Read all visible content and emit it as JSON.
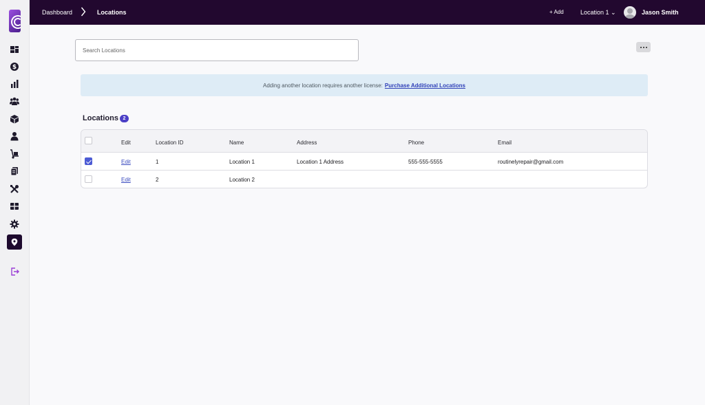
{
  "sidebar": {
    "items": [
      {
        "icon": "dashboard-icon"
      },
      {
        "icon": "dollar-icon"
      },
      {
        "icon": "bar-chart-icon"
      },
      {
        "icon": "users-icon"
      },
      {
        "icon": "box-icon"
      },
      {
        "icon": "user-icon"
      },
      {
        "icon": "hand-truck-icon"
      },
      {
        "icon": "clipboard-icon"
      },
      {
        "icon": "tools-icon"
      },
      {
        "icon": "cash-register-icon"
      },
      {
        "icon": "gear-icon"
      },
      {
        "icon": "location-pin-icon",
        "active": true
      },
      {
        "icon": "logout-icon"
      }
    ],
    "accent": "#1e0a2e"
  },
  "header": {
    "breadcrumb_home": "Dashboard",
    "breadcrumb_current": "Locations",
    "add_label": "+ Add",
    "location_selector": "Location 1 ⌄",
    "user_name": "Jason Smith",
    "background": "#22082f"
  },
  "search": {
    "placeholder": "Search Locations",
    "value": ""
  },
  "banner": {
    "text": "Adding another location requires another license:",
    "link": "Purchase Additional Locations"
  },
  "section": {
    "title": "Locations",
    "count": "2"
  },
  "table": {
    "columns": {
      "edit": "Edit",
      "location_id": "Location ID",
      "name": "Name",
      "address": "Address",
      "phone": "Phone",
      "email": "Email"
    },
    "rows": [
      {
        "checked": true,
        "edit": "Edit",
        "location_id": "1",
        "name": "Location 1",
        "address": "Location 1 Address",
        "phone": "555-555-5555",
        "email": "routinelyrepair@gmail.com"
      },
      {
        "checked": false,
        "edit": "Edit",
        "location_id": "2",
        "name": "Location 2",
        "address": "",
        "phone": "",
        "email": ""
      }
    ]
  }
}
